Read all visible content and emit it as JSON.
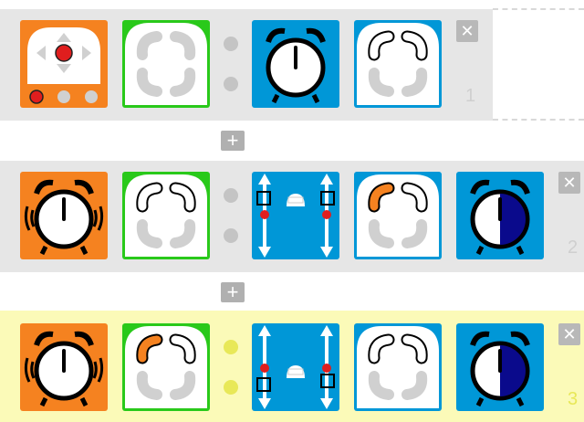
{
  "colors": {
    "event_orange": "#f58220",
    "action_blue": "#0097d7",
    "state_green": "#29c91a",
    "row_gray": "#e6e6e6",
    "row_yellow": "#fbfab8",
    "dot_gray": "#c4c4c4",
    "dot_yellow": "#e8e858",
    "led_red": "#e01e1e",
    "dark_blue": "#0a0a8c"
  },
  "rows": [
    {
      "number": "1",
      "close_label": "✕",
      "tiles": [
        {
          "kind": "event",
          "icon": "button-pad-icon"
        },
        {
          "kind": "state",
          "icon": "state-blank-icon"
        },
        {
          "kind": "action",
          "icon": "alarm-clock-icon"
        },
        {
          "kind": "action",
          "icon": "state-blank-icon"
        }
      ]
    },
    {
      "number": "2",
      "close_label": "✕",
      "tiles": [
        {
          "kind": "event",
          "icon": "ringing-alarm-icon"
        },
        {
          "kind": "state",
          "icon": "state-blank-icon"
        },
        {
          "kind": "action",
          "icon": "motor-slider-icon"
        },
        {
          "kind": "action",
          "icon": "state-set-icon"
        },
        {
          "kind": "action",
          "icon": "timer-icon"
        }
      ]
    },
    {
      "number": "3",
      "close_label": "✕",
      "tiles": [
        {
          "kind": "event",
          "icon": "ringing-alarm-icon"
        },
        {
          "kind": "state",
          "icon": "state-set-icon"
        },
        {
          "kind": "action",
          "icon": "motor-slider-icon"
        },
        {
          "kind": "action",
          "icon": "state-blank-icon"
        },
        {
          "kind": "action",
          "icon": "timer-icon"
        }
      ]
    }
  ],
  "add_label": "+"
}
